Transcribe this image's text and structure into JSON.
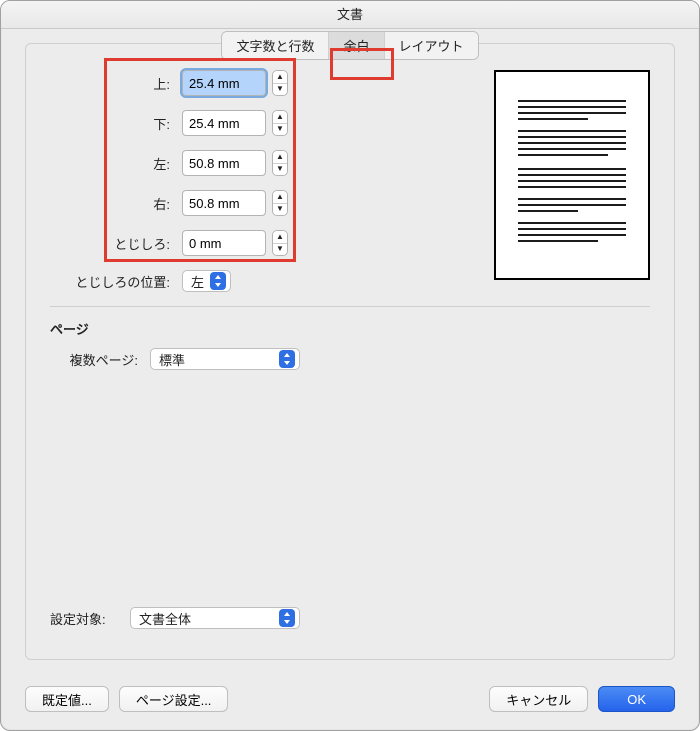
{
  "title": "文書",
  "tabs": {
    "chars": "文字数と行数",
    "margins": "余白",
    "layout": "レイアウト"
  },
  "margins": {
    "top": {
      "label": "上:",
      "value": "25.4 mm"
    },
    "bottom": {
      "label": "下:",
      "value": "25.4 mm"
    },
    "left": {
      "label": "左:",
      "value": "50.8 mm"
    },
    "right": {
      "label": "右:",
      "value": "50.8 mm"
    },
    "gutter": {
      "label": "とじしろ:",
      "value": "0 mm"
    }
  },
  "gutterPos": {
    "label": "とじしろの位置:",
    "value": "左"
  },
  "sectionPage": "ページ",
  "multiPage": {
    "label": "複数ページ:",
    "value": "標準"
  },
  "applyTo": {
    "label": "設定対象:",
    "value": "文書全体"
  },
  "buttons": {
    "defaults": "既定値...",
    "pageSetup": "ページ設定...",
    "cancel": "キャンセル",
    "ok": "OK"
  }
}
